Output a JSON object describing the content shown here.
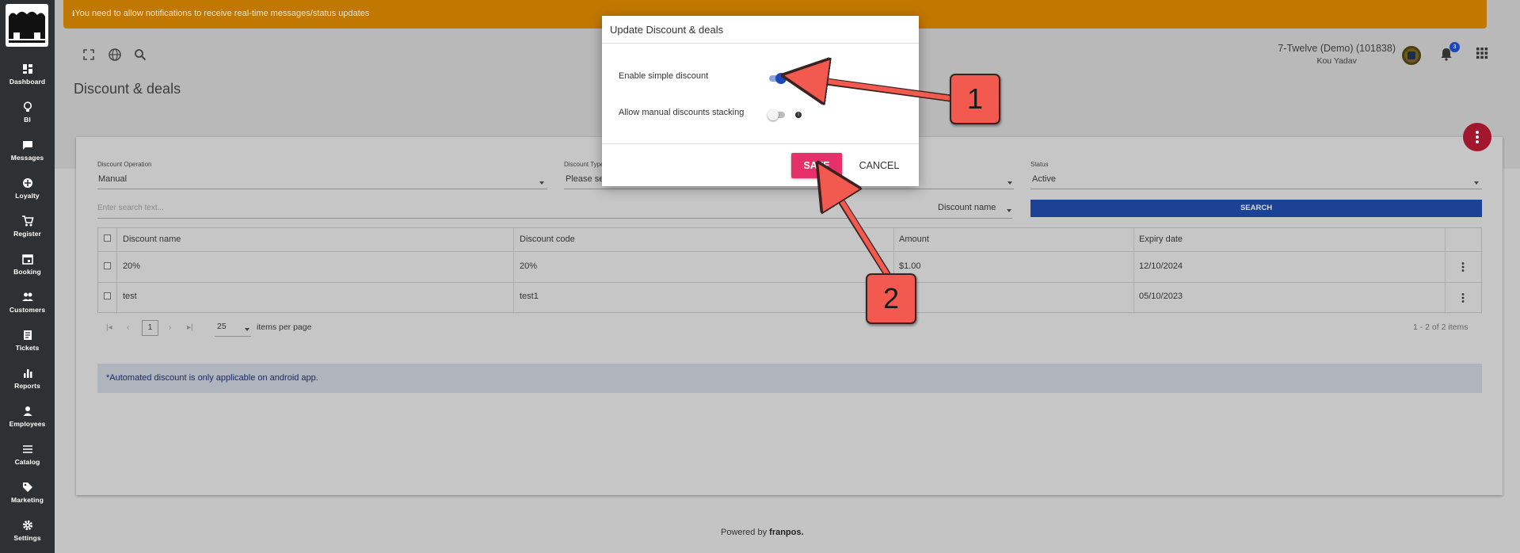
{
  "sidebar": {
    "items": [
      {
        "label": "Dashboard",
        "icon": "dashboard-icon"
      },
      {
        "label": "BI",
        "icon": "lightbulb-icon"
      },
      {
        "label": "Messages",
        "icon": "chat-bubble-icon"
      },
      {
        "label": "Loyalty",
        "icon": "loyalty-icon"
      },
      {
        "label": "Register",
        "icon": "cart-icon"
      },
      {
        "label": "Booking",
        "icon": "calendar-icon"
      },
      {
        "label": "Customers",
        "icon": "people-icon"
      },
      {
        "label": "Tickets",
        "icon": "ticket-icon"
      },
      {
        "label": "Reports",
        "icon": "bar-chart-icon"
      },
      {
        "label": "Employees",
        "icon": "person-icon"
      },
      {
        "label": "Catalog",
        "icon": "list-icon"
      },
      {
        "label": "Marketing",
        "icon": "tag-icon"
      },
      {
        "label": "Settings",
        "icon": "gear-icon"
      }
    ]
  },
  "notification": "You need to allow notifications to receive real-time messages/status updates",
  "header": {
    "page_title": "Discount & deals",
    "store_name": "7-Twelve (Demo) (101838)",
    "user_name": "Kou Yadav",
    "bell_badge": "3"
  },
  "filters": {
    "discount_operation": {
      "label": "Discount Operation",
      "value": "Manual"
    },
    "discount_type": {
      "label": "Discount Type",
      "value": "Please se"
    },
    "status": {
      "label": "Status",
      "value": "Active"
    },
    "search_placeholder": "Enter search text...",
    "search_by": "Discount name",
    "search_button": "SEARCH"
  },
  "table": {
    "headers": [
      "Discount name",
      "Discount code",
      "Amount",
      "Expiry date"
    ],
    "rows": [
      {
        "name": "20%",
        "code": "20%",
        "amount": "$1.00",
        "expiry": "12/10/2024"
      },
      {
        "name": "test",
        "code": "test1",
        "amount": "",
        "expiry": "05/10/2023"
      }
    ]
  },
  "pagination": {
    "page": "1",
    "per_page": "25",
    "per_page_label": "items per page",
    "summary": "1 - 2 of 2 items"
  },
  "info_note": "*Automated discount is only applicable on android app.",
  "footer": {
    "powered_by": "Powered by",
    "brand": "franpos."
  },
  "dialog": {
    "title": "Update Discount & deals",
    "options": [
      {
        "label": "Enable simple discount",
        "enabled": true
      },
      {
        "label": "Allow manual discounts stacking",
        "enabled": false
      }
    ],
    "save_label": "SAVE",
    "cancel_label": "CANCEL"
  },
  "annotations": {
    "callout_1": "1",
    "callout_2": "2",
    "arrow_color": "#f25a4f"
  },
  "colors": {
    "sidebar": "#2e3133",
    "notification": "#c17800",
    "primary": "#1c4296",
    "save": "#e5306a",
    "fab": "#a3172e",
    "toggle_on": "#1e47b8"
  }
}
